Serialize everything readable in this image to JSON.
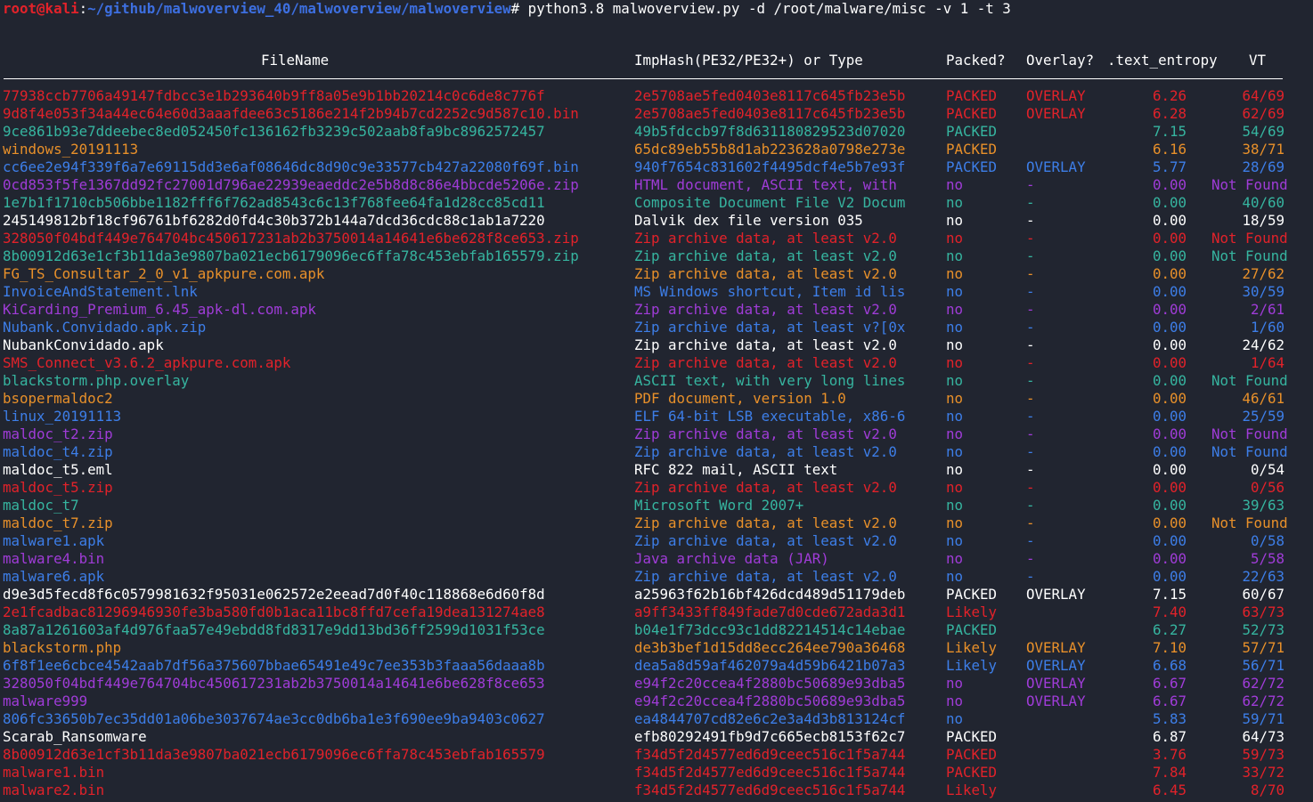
{
  "prompt": {
    "user": "root@kali",
    "colon": ":",
    "path": "~/github/malwoverview_40/malwoverview/malwoverview",
    "command": "# python3.8 malwoverview.py -d /root/malware/misc -v 1 -t 3"
  },
  "colors": {
    "background": "#212530",
    "red": "#e2222a",
    "teal": "#36b5a0",
    "orange": "#e8902a",
    "blue": "#3d7ee8",
    "purple": "#a03cd8",
    "white": "#ffffff"
  },
  "headers": {
    "filename": "FileName",
    "imphash": "ImpHash(PE32/PE32+) or Type",
    "packed": "Packed?",
    "overlay": "Overlay?",
    "entropy": ".text_entropy",
    "vt": "VT"
  },
  "rows": [
    {
      "color": "red",
      "fn": "77938ccb7706a49147fdbcc3e1b293640b9ff8a05e9b1bb20214c0c6de8c776f",
      "ih": "2e5708ae5fed0403e8117c645fb23e5b",
      "pk": "PACKED",
      "ov": "OVERLAY",
      "en": "6.26",
      "vt": "64/69"
    },
    {
      "color": "red",
      "fn": "9d8f4e053f34a44ec64e60d3aaafdee63c5186e214f2b94b7cd2252c9d587c10.bin",
      "ih": "2e5708ae5fed0403e8117c645fb23e5b",
      "pk": "PACKED",
      "ov": "OVERLAY",
      "en": "6.28",
      "vt": "62/69"
    },
    {
      "color": "teal",
      "fn": "9ce861b93e7ddeebec8ed052450fc136162fb3239c502aab8fa9bc8962572457",
      "ih": "49b5fdccb97f8d631180829523d07020",
      "pk": "PACKED",
      "ov": "",
      "en": "7.15",
      "vt": "54/69"
    },
    {
      "color": "orange",
      "fn": "windows_20191113",
      "ih": "65dc89eb55b8d1ab223628a0798e273e",
      "pk": "PACKED",
      "ov": "",
      "en": "6.16",
      "vt": "38/71"
    },
    {
      "color": "blue",
      "fn": "cc6ee2e94f339f6a7e69115dd3e6af08646dc8d90c9e33577cb427a22080f69f.bin",
      "ih": "940f7654c831602f4495dcf4e5b7e93f",
      "pk": "PACKED",
      "ov": "OVERLAY",
      "en": "5.77",
      "vt": "28/69"
    },
    {
      "color": "purple",
      "fn": "0cd853f5fe1367dd92fc27001d796ae22939eaeddc2e5b8d8c86e4bbcde5206e.zip",
      "ih": "HTML document, ASCII text, with",
      "pk": "no",
      "ov": "-",
      "en": "0.00",
      "vt": "Not Found"
    },
    {
      "color": "teal",
      "fn": "1e7b1f1710cb506bbe1182fff6f762ad8543c6c13f768fee64fa1d28cc85cd11",
      "ih": "Composite Document File V2 Docum",
      "pk": "no",
      "ov": "-",
      "en": "0.00",
      "vt": "40/60"
    },
    {
      "color": "white",
      "fn": "245149812bf18cf96761bf6282d0fd4c30b372b144a7dcd36cdc88c1ab1a7220",
      "ih": "Dalvik dex file version 035",
      "pk": "no",
      "ov": "-",
      "en": "0.00",
      "vt": "18/59"
    },
    {
      "color": "red",
      "fn": "328050f04bdf449e764704bc450617231ab2b3750014a14641e6be628f8ce653.zip",
      "ih": "Zip archive data, at least v2.0",
      "pk": "no",
      "ov": "-",
      "en": "0.00",
      "vt": "Not Found"
    },
    {
      "color": "teal",
      "fn": "8b00912d63e1cf3b11da3e9807ba021ecb6179096ec6ffa78c453ebfab165579.zip",
      "ih": "Zip archive data, at least v2.0",
      "pk": "no",
      "ov": "-",
      "en": "0.00",
      "vt": "Not Found"
    },
    {
      "color": "orange",
      "fn": "FG_TS_Consultar_2_0_v1_apkpure.com.apk",
      "ih": "Zip archive data, at least v2.0",
      "pk": "no",
      "ov": "-",
      "en": "0.00",
      "vt": "27/62"
    },
    {
      "color": "blue",
      "fn": "InvoiceAndStatement.lnk",
      "ih": "MS Windows shortcut, Item id lis",
      "pk": "no",
      "ov": "-",
      "en": "0.00",
      "vt": "30/59"
    },
    {
      "color": "purple",
      "fn": "KiCarding_Premium_6.45_apk-dl.com.apk",
      "ih": "Zip archive data, at least v2.0",
      "pk": "no",
      "ov": "-",
      "en": "0.00",
      "vt": "2/61"
    },
    {
      "color": "blue",
      "fn": "Nubank.Convidado.apk.zip",
      "ih": "Zip archive data, at least v?[0x",
      "pk": "no",
      "ov": "-",
      "en": "0.00",
      "vt": "1/60"
    },
    {
      "color": "white",
      "fn": "NubankConvidado.apk",
      "ih": "Zip archive data, at least v2.0",
      "pk": "no",
      "ov": "-",
      "en": "0.00",
      "vt": "24/62"
    },
    {
      "color": "red",
      "fn": "SMS_Connect_v3.6.2_apkpure.com.apk",
      "ih": "Zip archive data, at least v2.0",
      "pk": "no",
      "ov": "-",
      "en": "0.00",
      "vt": "1/64"
    },
    {
      "color": "teal",
      "fn": "blackstorm.php.overlay",
      "ih": "ASCII text, with very long lines",
      "pk": "no",
      "ov": "-",
      "en": "0.00",
      "vt": "Not Found"
    },
    {
      "color": "orange",
      "fn": "bsopermaldoc2",
      "ih": "PDF document, version 1.0",
      "pk": "no",
      "ov": "-",
      "en": "0.00",
      "vt": "46/61"
    },
    {
      "color": "blue",
      "fn": "linux_20191113",
      "ih": "ELF 64-bit LSB executable, x86-6",
      "pk": "no",
      "ov": "-",
      "en": "0.00",
      "vt": "25/59"
    },
    {
      "color": "purple",
      "fn": "maldoc_t2.zip",
      "ih": "Zip archive data, at least v2.0",
      "pk": "no",
      "ov": "-",
      "en": "0.00",
      "vt": "Not Found"
    },
    {
      "color": "blue",
      "fn": "maldoc_t4.zip",
      "ih": "Zip archive data, at least v2.0",
      "pk": "no",
      "ov": "-",
      "en": "0.00",
      "vt": "Not Found"
    },
    {
      "color": "white",
      "fn": "maldoc_t5.eml",
      "ih": "RFC 822 mail, ASCII text",
      "pk": "no",
      "ov": "-",
      "en": "0.00",
      "vt": "0/54"
    },
    {
      "color": "red",
      "fn": "maldoc_t5.zip",
      "ih": "Zip archive data, at least v2.0",
      "pk": "no",
      "ov": "-",
      "en": "0.00",
      "vt": "0/56"
    },
    {
      "color": "teal",
      "fn": "maldoc_t7",
      "ih": "Microsoft Word 2007+",
      "pk": "no",
      "ov": "-",
      "en": "0.00",
      "vt": "39/63"
    },
    {
      "color": "orange",
      "fn": "maldoc_t7.zip",
      "ih": "Zip archive data, at least v2.0",
      "pk": "no",
      "ov": "-",
      "en": "0.00",
      "vt": "Not Found"
    },
    {
      "color": "blue",
      "fn": "malware1.apk",
      "ih": "Zip archive data, at least v2.0",
      "pk": "no",
      "ov": "-",
      "en": "0.00",
      "vt": "0/58"
    },
    {
      "color": "purple",
      "fn": "malware4.bin",
      "ih": "Java archive data (JAR)",
      "pk": "no",
      "ov": "-",
      "en": "0.00",
      "vt": "5/58"
    },
    {
      "color": "blue",
      "fn": "malware6.apk",
      "ih": "Zip archive data, at least v2.0",
      "pk": "no",
      "ov": "-",
      "en": "0.00",
      "vt": "22/63"
    },
    {
      "color": "white",
      "fn": "d9e3d5fecd8f6c0579981632f95031e062572e2eead7d0f40c118868e6d60f8d",
      "ih": "a25963f62b16bf426dcd489d51179deb",
      "pk": "PACKED",
      "ov": "OVERLAY",
      "en": "7.15",
      "vt": "60/67"
    },
    {
      "color": "red",
      "fn": "2e1fcadbac81296946930fe3ba580fd0b1aca11bc8ffd7cefa19dea131274ae8",
      "ih": "a9ff3433ff849fade7d0cde672ada3d1",
      "pk": "Likely",
      "ov": "",
      "en": "7.40",
      "vt": "63/73"
    },
    {
      "color": "teal",
      "fn": "8a87a1261603af4d976faa57e49ebdd8fd8317e9dd13bd36ff2599d1031f53ce",
      "ih": "b04e1f73dcc93c1dd82214514c14ebae",
      "pk": "PACKED",
      "ov": "",
      "en": "6.27",
      "vt": "52/73"
    },
    {
      "color": "orange",
      "fn": "blackstorm.php",
      "ih": "de3b3bef1d15dd8ecc264ee790a36468",
      "pk": "Likely",
      "ov": "OVERLAY",
      "en": "7.10",
      "vt": "57/71"
    },
    {
      "color": "blue",
      "fn": "6f8f1ee6cbce4542aab7df56a375607bbae65491e49c7ee353b3faaa56daaa8b",
      "ih": "dea5a8d59af462079a4d59b6421b07a3",
      "pk": "Likely",
      "ov": "OVERLAY",
      "en": "6.68",
      "vt": "56/71"
    },
    {
      "color": "purple",
      "fn": "328050f04bdf449e764704bc450617231ab2b3750014a14641e6be628f8ce653",
      "ih": "e94f2c20ccea4f2880bc50689e93dba5",
      "pk": "no",
      "ov": "OVERLAY",
      "en": "6.67",
      "vt": "62/72"
    },
    {
      "color": "purple",
      "fn": "malware999",
      "ih": "e94f2c20ccea4f2880bc50689e93dba5",
      "pk": "no",
      "ov": "OVERLAY",
      "en": "6.67",
      "vt": "62/72"
    },
    {
      "color": "blue",
      "fn": "806fc33650b7ec35dd01a06be3037674ae3cc0db6ba1e3f690ee9ba9403c0627",
      "ih": "ea4844707cd82e6c2e3a4d3b813124cf",
      "pk": "no",
      "ov": "",
      "en": "5.83",
      "vt": "59/71"
    },
    {
      "color": "white",
      "fn": "Scarab_Ransomware",
      "ih": "efb80292491fb9d7c665ecb8153f62c7",
      "pk": "PACKED",
      "ov": "",
      "en": "6.87",
      "vt": "64/73"
    },
    {
      "color": "red",
      "fn": "8b00912d63e1cf3b11da3e9807ba021ecb6179096ec6ffa78c453ebfab165579",
      "ih": "f34d5f2d4577ed6d9ceec516c1f5a744",
      "pk": "PACKED",
      "ov": "",
      "en": "3.76",
      "vt": "59/73"
    },
    {
      "color": "red",
      "fn": "malware1.bin",
      "ih": "f34d5f2d4577ed6d9ceec516c1f5a744",
      "pk": "PACKED",
      "ov": "",
      "en": "7.84",
      "vt": "33/72"
    },
    {
      "color": "red",
      "fn": "malware2.bin",
      "ih": "f34d5f2d4577ed6d9ceec516c1f5a744",
      "pk": "Likely",
      "ov": "",
      "en": "6.45",
      "vt": "8/70"
    }
  ]
}
